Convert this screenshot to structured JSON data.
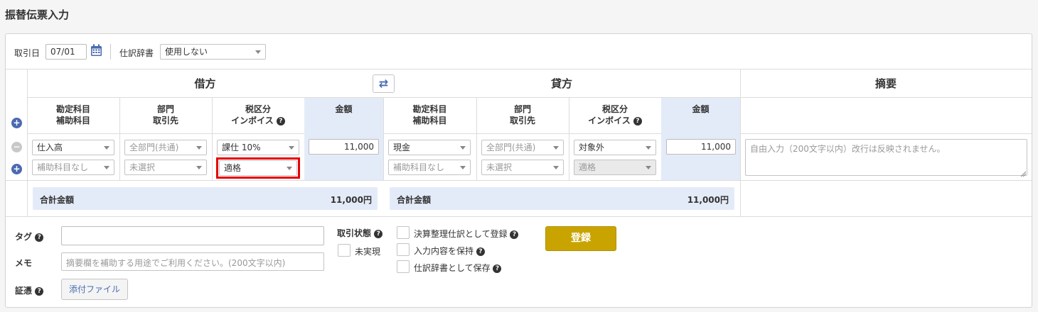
{
  "page": {
    "title": "振替伝票入力"
  },
  "header": {
    "date_label": "取引日",
    "date_value": "07/01",
    "dictionary_label": "仕訳辞書",
    "dictionary_value": "使用しない"
  },
  "sections": {
    "debit": "借方",
    "credit": "貸方",
    "summary": "摘要",
    "swap_symbol": "⇄"
  },
  "columns": {
    "account": [
      "勘定科目",
      "補助科目"
    ],
    "department": [
      "部門",
      "取引先"
    ],
    "tax": [
      "税区分",
      "インボイス"
    ],
    "amount": "金額"
  },
  "help_glyph": "?",
  "row": {
    "remove_symbol": "−",
    "add_symbol": "+",
    "debit": {
      "account": "仕入高",
      "sub_account": "補助科目なし",
      "department": "全部門(共通)",
      "partner": "未選択",
      "tax": "課仕 10%",
      "invoice": "適格",
      "amount": "11,000"
    },
    "credit": {
      "account": "現金",
      "sub_account": "補助科目なし",
      "department": "全部門(共通)",
      "partner": "未選択",
      "tax": "対象外",
      "invoice": "適格",
      "amount": "11,000"
    },
    "summary_placeholder": "自由入力（200文字以内）改行は反映されません。"
  },
  "totals": {
    "label": "合計金額",
    "debit_value": "11,000円",
    "credit_value": "11,000円"
  },
  "footer": {
    "tag_label": "タグ",
    "memo_label": "メモ",
    "memo_placeholder": "摘要欄を補助する用途でご利用ください。(200文字以内)",
    "evidence_label": "証憑",
    "attach_button": "添付ファイル",
    "status_label": "取引状態",
    "unrealized_label": "未実現",
    "adjusting_label": "決算整理仕訳として登録",
    "keep_input_label": "入力内容を保持",
    "save_dictionary_label": "仕訳辞書として保存",
    "register_button": "登録"
  },
  "colors": {
    "accent_blue": "#4a6ab0",
    "header_blue": "#e4ebf8",
    "register_gold": "#c9a400",
    "highlight_red": "#e60000"
  }
}
